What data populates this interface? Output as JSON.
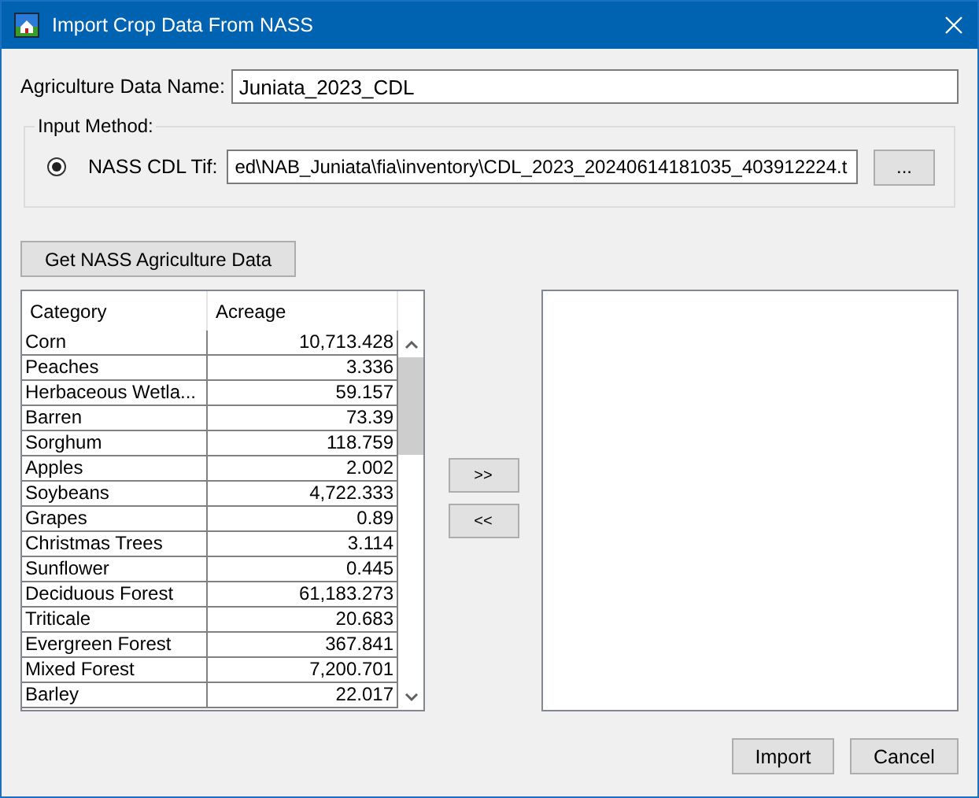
{
  "window": {
    "title": "Import Crop Data From NASS"
  },
  "name_field": {
    "label": "Agriculture Data Name:",
    "value": "Juniata_2023_CDL"
  },
  "input_method": {
    "title": "Input Method:",
    "options": [
      {
        "label": "NASS CDL Tif:",
        "selected": true,
        "value": "ed\\NAB_Juniata\\fia\\inventory\\CDL_2023_20240614181035_403912224.t",
        "browse": "..."
      }
    ]
  },
  "get_button": "Get NASS Agriculture Data",
  "table": {
    "columns": [
      "Category",
      "Acreage"
    ],
    "rows": [
      {
        "category": "Corn",
        "acreage": "10,713.428"
      },
      {
        "category": "Peaches",
        "acreage": "3.336"
      },
      {
        "category": "Herbaceous Wetla...",
        "acreage": "59.157"
      },
      {
        "category": "Barren",
        "acreage": "73.39"
      },
      {
        "category": "Sorghum",
        "acreage": "118.759"
      },
      {
        "category": "Apples",
        "acreage": "2.002"
      },
      {
        "category": "Soybeans",
        "acreage": "4,722.333"
      },
      {
        "category": "Grapes",
        "acreage": "0.89"
      },
      {
        "category": "Christmas Trees",
        "acreage": "3.114"
      },
      {
        "category": "Sunflower",
        "acreage": "0.445"
      },
      {
        "category": "Deciduous Forest",
        "acreage": "61,183.273"
      },
      {
        "category": "Triticale",
        "acreage": "20.683"
      },
      {
        "category": "Evergreen Forest",
        "acreage": "367.841"
      },
      {
        "category": "Mixed Forest",
        "acreage": "7,200.701"
      },
      {
        "category": "Barley",
        "acreage": "22.017"
      }
    ]
  },
  "move_buttons": [
    ">>",
    "<<"
  ],
  "buttons": [
    "Import",
    "Cancel"
  ]
}
